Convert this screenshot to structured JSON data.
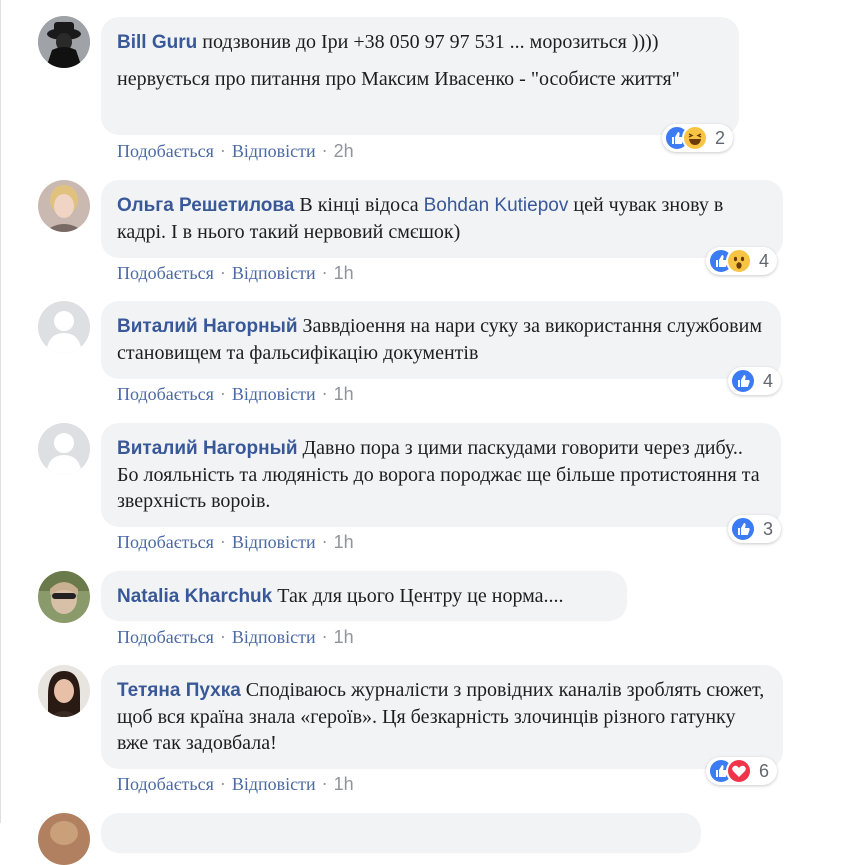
{
  "comments": [
    {
      "author": "Bill Guru",
      "text": "подзвонив до Іри +38 050 97 97 531 ... морозиться ))))",
      "text2": "нервується про питання про Максим Ивасенко - \"особисте життя\"",
      "like_label": "Подобається",
      "reply_label": "Відповісти",
      "time": "2h",
      "reactions": [
        "like-icon",
        "haha-icon"
      ],
      "reaction_count": "2"
    },
    {
      "author": "Ольга Решетилова",
      "text_before": "В кінці відоса",
      "mention": "Bohdan Kutiepov",
      "text_after": "цей чувак знову в кадрі. І в нього такий нервовий смєшок)",
      "like_label": "Подобається",
      "reply_label": "Відповісти",
      "time": "1h",
      "reactions": [
        "like-icon",
        "wow-icon"
      ],
      "reaction_count": "4"
    },
    {
      "author": "Виталий Нагорный",
      "text": "Заввдіоення на нари суку за використання службовим становищем та фальсифікацію документів",
      "like_label": "Подобається",
      "reply_label": "Відповісти",
      "time": "1h",
      "reactions": [
        "like-icon"
      ],
      "reaction_count": "4"
    },
    {
      "author": "Виталий Нагорный",
      "text": "Давно пора з цими паскудами говорити через дибу.. Бо лояльність та людяність до ворога породжає ще більше протистояння та зверхність вороів.",
      "like_label": "Подобається",
      "reply_label": "Відповісти",
      "time": "1h",
      "reactions": [
        "like-icon"
      ],
      "reaction_count": "3"
    },
    {
      "author": "Natalia Kharchuk",
      "text": "Так для цього Центру це норма....",
      "like_label": "Подобається",
      "reply_label": "Відповісти",
      "time": "1h"
    },
    {
      "author": "Тетяна Пухка",
      "text": "Сподіваюсь журналісти з провідних каналів зроблять сюжет, щоб вся країна знала «героїв». Ця безкарність злочинців різного гатунку вже так задовбала!",
      "like_label": "Подобається",
      "reply_label": "Відповісти",
      "time": "1h",
      "reactions": [
        "like-icon",
        "love-icon"
      ],
      "reaction_count": "6"
    }
  ],
  "separator": "·",
  "colors": {
    "author": "#385898",
    "bubble": "#f2f3f5",
    "meta": "#90949c",
    "like": "#3b7cf4"
  }
}
